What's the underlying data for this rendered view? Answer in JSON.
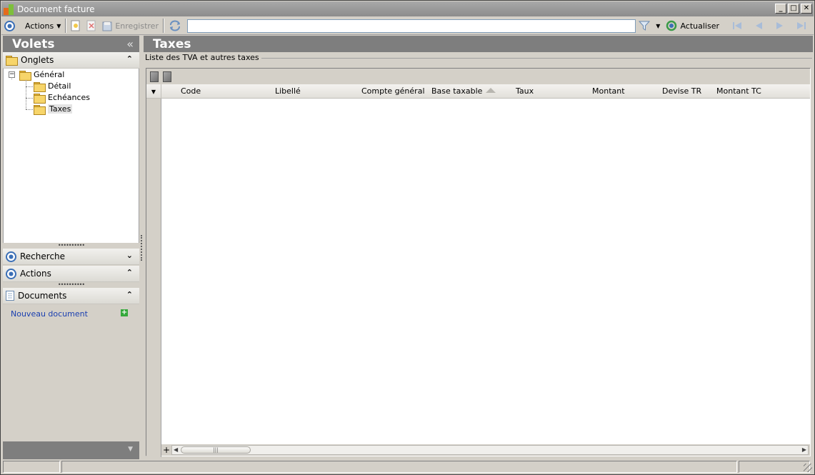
{
  "window": {
    "title": "Document facture",
    "minimize": "_",
    "maximize": "□",
    "close": "✕"
  },
  "toolbar": {
    "actions_label": "Actions",
    "save_label": "Enregistrer",
    "refresh_label": "Actualiser",
    "search_value": ""
  },
  "left_pane": {
    "title": "Volets",
    "collapse_glyph": "«",
    "onglets": {
      "label": "Onglets",
      "chevron": "⌃",
      "tree": {
        "root": "Général",
        "root_expander": "−",
        "children": [
          "Détail",
          "Echéances",
          "Taxes"
        ],
        "selected": "Taxes"
      }
    },
    "recherche": {
      "label": "Recherche",
      "chevron": "⌄"
    },
    "actions": {
      "label": "Actions",
      "chevron": "⌃"
    },
    "documents": {
      "label": "Documents",
      "chevron": "⌃",
      "link": "Nouveau document",
      "add_glyph": "+"
    }
  },
  "right_pane": {
    "title": "Taxes",
    "group_title": "Liste des TVA et autres taxes",
    "grid": {
      "columns": [
        "Code",
        "Libellé",
        "Compte général",
        "Base taxable",
        "Taux",
        "Montant",
        "Devise TR",
        "Montant TC"
      ],
      "rows": [],
      "add_row_glyph": "+"
    }
  },
  "colors": {
    "header_gray": "#7e7e7e",
    "link_blue": "#1a3fb0",
    "accent_blue": "#3b6fb6"
  }
}
